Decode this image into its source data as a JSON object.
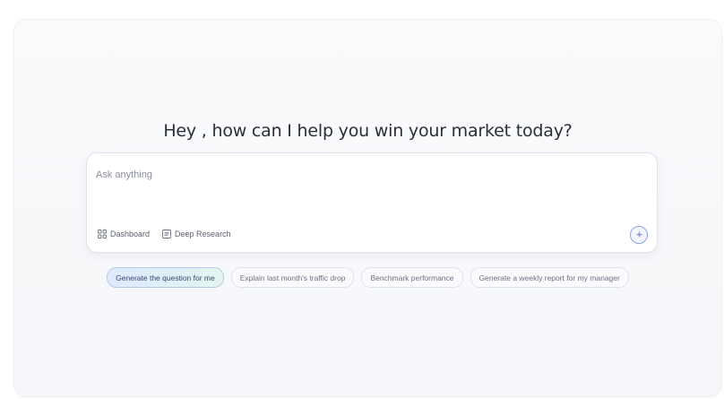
{
  "greeting": "Hey , how can I help you win your market today?",
  "prompt": {
    "placeholder": "Ask anything",
    "value": ""
  },
  "tools": [
    {
      "label": "Dashboard",
      "icon": "dashboard-grid-icon"
    },
    {
      "label": "Deep Research",
      "icon": "document-icon"
    }
  ],
  "send_icon": "sparkle-send-icon",
  "suggestions": [
    {
      "label": "Generate the question for me",
      "highlighted": true
    },
    {
      "label": "Explain last month's traffic drop",
      "highlighted": false
    },
    {
      "label": "Benchmark performance",
      "highlighted": false
    },
    {
      "label": "Generate a weekly report for my manager",
      "highlighted": false
    }
  ],
  "colors": {
    "accent": "#8ba3e8",
    "highlight_chip_start": "#dfe9ff",
    "highlight_chip_end": "#e2f5ee"
  }
}
